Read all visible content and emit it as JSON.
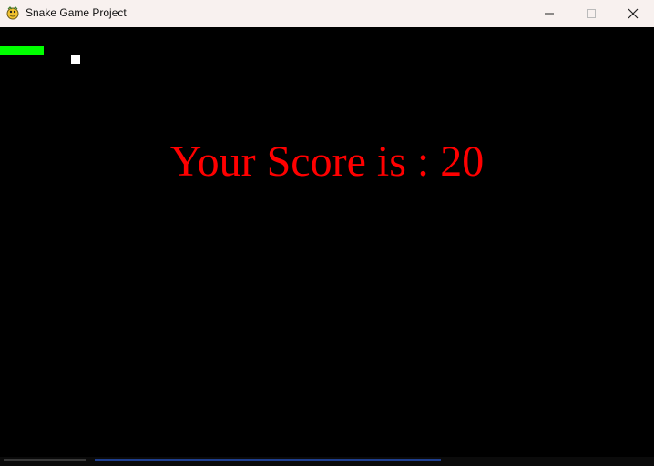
{
  "window": {
    "title": "Snake Game Project",
    "icon": "pygame-snake-icon",
    "controls": {
      "minimize": "minimize-icon",
      "maximize": "maximize-icon",
      "close": "close-icon"
    }
  },
  "game": {
    "score_message": "Your Score is : 20",
    "colors": {
      "background": "#000000",
      "snake": "#00ff00",
      "food": "#ffffff",
      "score_text": "#ff0000"
    }
  }
}
